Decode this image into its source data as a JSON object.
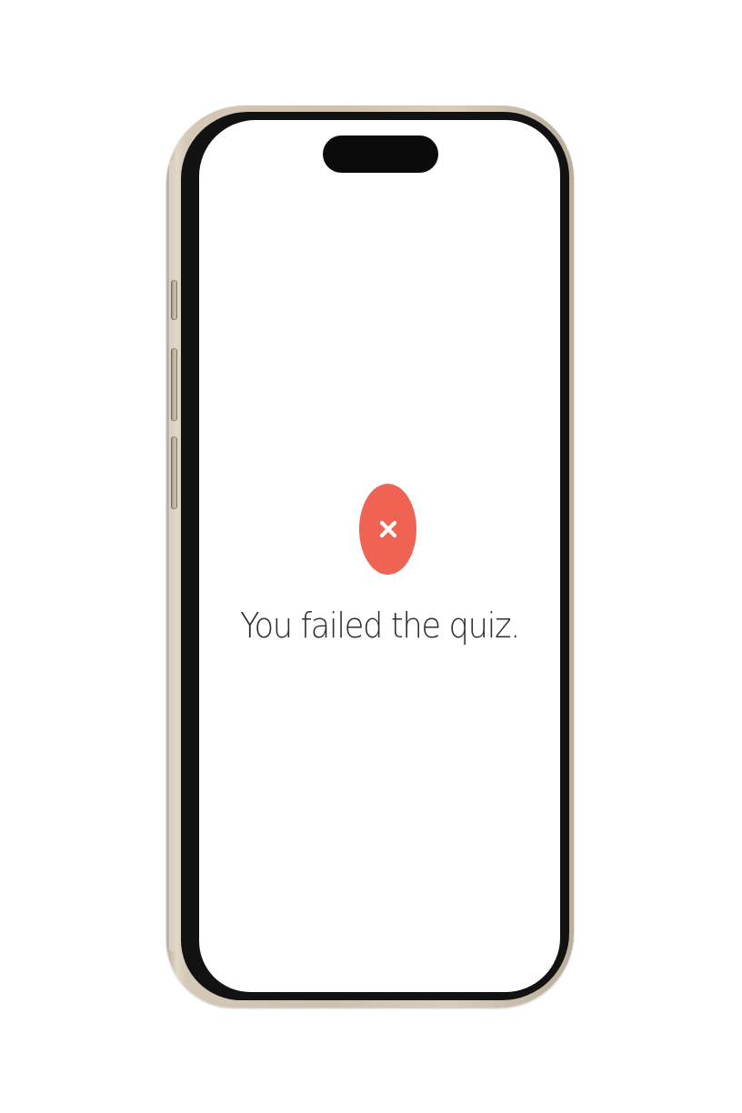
{
  "quiz_result": {
    "message": "You failed the quiz.",
    "status_icon": "x-mark-icon",
    "status_color": "#ef6355"
  },
  "device": {
    "frame_color": "#d4c8b6",
    "screen_color": "#ffffff"
  }
}
